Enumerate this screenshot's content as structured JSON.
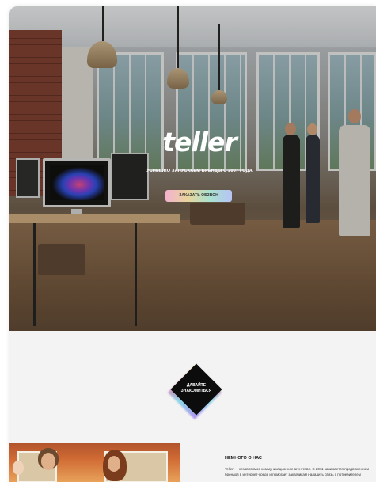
{
  "hero": {
    "logo_text": "teller",
    "tagline": "УСПЕШНО ЗАПУСКАЕМ БРЕНДЫ С 2007 ГОДА",
    "cta_label": "ЗАКАЗАТЬ ОБЗВОН"
  },
  "contact": {
    "label": "ДАВАЙТЕ\nЗНАКОМИТЬСЯ"
  },
  "about": {
    "title": "НЕМНОГО О НАС",
    "text": "Teller — независимое коммуникационное агентство. С 2011 занимается продвижением брендов в интернет-среде и помогает заказчикам наладить связь с потребителем"
  },
  "colors": {
    "page_bg": "#f1f1f1",
    "diamond": "#0c0c0c",
    "cta_gradient_start": "#f3b2d0",
    "cta_gradient_end": "#b7c3f4"
  }
}
